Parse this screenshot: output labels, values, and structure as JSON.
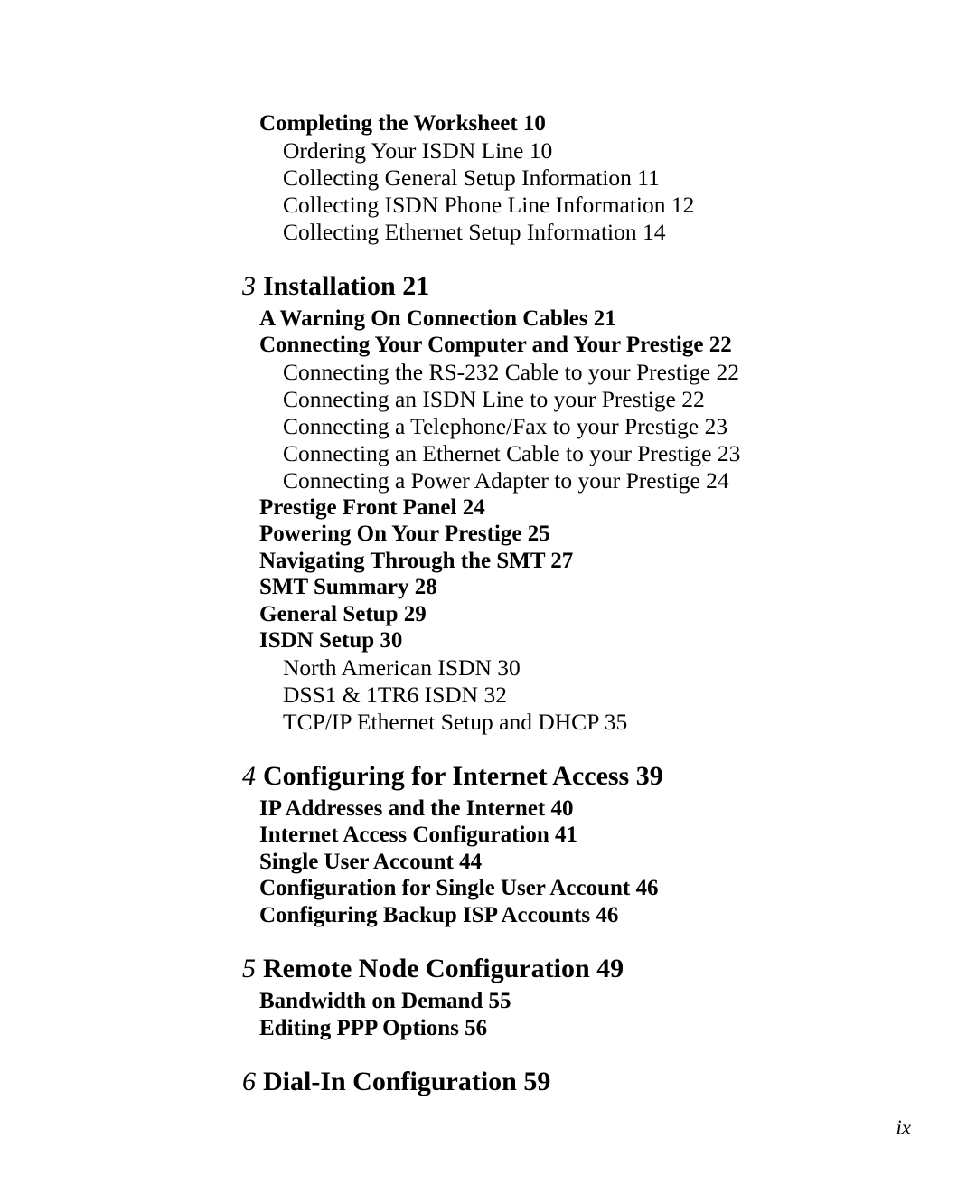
{
  "page": {
    "folio": "ix",
    "background_color": "#ffffff",
    "text_color": "#000000"
  },
  "toc": {
    "entries": [
      {
        "level": 2,
        "label": "Completing the Worksheet 10",
        "title": "Completing the Worksheet",
        "page": "10"
      },
      {
        "level": 3,
        "label": "Ordering Your ISDN Line 10",
        "title": "Ordering Your ISDN Line",
        "page": "10"
      },
      {
        "level": 3,
        "label": "Collecting General Setup Information 11",
        "title": "Collecting General Setup Information",
        "page": "11"
      },
      {
        "level": 3,
        "label": "Collecting ISDN Phone Line Information 12",
        "title": "Collecting ISDN Phone Line Information",
        "page": "12"
      },
      {
        "level": 3,
        "label": "Collecting Ethernet Setup Information 14",
        "title": "Collecting Ethernet Setup Information",
        "page": "14"
      },
      {
        "level": 1,
        "number": "3",
        "label": "Installation 21",
        "title": "Installation",
        "page": "21"
      },
      {
        "level": 2,
        "label": "A Warning On Connection Cables 21",
        "title": "A Warning On Connection Cables",
        "page": "21"
      },
      {
        "level": 2,
        "label": "Connecting Your Computer and Your Prestige 22",
        "title": "Connecting Your Computer and Your Prestige",
        "page": "22"
      },
      {
        "level": 3,
        "label": "Connecting the RS-232 Cable to your Prestige 22",
        "title": "Connecting the RS-232 Cable to your Prestige",
        "page": "22"
      },
      {
        "level": 3,
        "label": "Connecting an ISDN Line to your Prestige 22",
        "title": "Connecting an ISDN Line to your Prestige",
        "page": "22"
      },
      {
        "level": 3,
        "label": "Connecting a Telephone/Fax to your Prestige 23",
        "title": "Connecting a Telephone/Fax to your Prestige",
        "page": "23"
      },
      {
        "level": 3,
        "label": "Connecting an Ethernet Cable to your Prestige 23",
        "title": "Connecting an Ethernet Cable to your Prestige",
        "page": "23"
      },
      {
        "level": 3,
        "label": "Connecting a Power Adapter to your Prestige 24",
        "title": "Connecting a Power Adapter to your Prestige",
        "page": "24"
      },
      {
        "level": 2,
        "label": "Prestige Front Panel 24",
        "title": "Prestige Front Panel",
        "page": "24"
      },
      {
        "level": 2,
        "label": "Powering On Your Prestige 25",
        "title": "Powering On Your Prestige",
        "page": "25"
      },
      {
        "level": 2,
        "label": "Navigating Through the SMT 27",
        "title": "Navigating Through the SMT",
        "page": "27"
      },
      {
        "level": 2,
        "label": "SMT Summary 28",
        "title": "SMT Summary",
        "page": "28"
      },
      {
        "level": 2,
        "label": "General Setup 29",
        "title": "General Setup",
        "page": "29"
      },
      {
        "level": 2,
        "label": "ISDN Setup 30",
        "title": "ISDN Setup",
        "page": "30"
      },
      {
        "level": 3,
        "label": "North American ISDN 30",
        "title": "North American ISDN",
        "page": "30"
      },
      {
        "level": 3,
        "label": "DSS1 & 1TR6 ISDN 32",
        "title": "DSS1 & 1TR6 ISDN",
        "page": "32"
      },
      {
        "level": 3,
        "label": "TCP/IP Ethernet Setup and DHCP 35",
        "title": "TCP/IP Ethernet Setup and DHCP",
        "page": "35"
      },
      {
        "level": 1,
        "number": "4",
        "label": "Configuring for Internet Access 39",
        "title": "Configuring for Internet Access",
        "page": "39"
      },
      {
        "level": 2,
        "label": "IP Addresses and the Internet 40",
        "title": "IP Addresses and the Internet",
        "page": "40"
      },
      {
        "level": 2,
        "label": "Internet Access Configuration 41",
        "title": "Internet Access Configuration",
        "page": "41"
      },
      {
        "level": 2,
        "label": "Single User Account 44",
        "title": "Single User Account",
        "page": "44"
      },
      {
        "level": 2,
        "label": "Configuration for Single User Account 46",
        "title": "Configuration for Single User Account",
        "page": "46"
      },
      {
        "level": 2,
        "label": "Configuring Backup ISP Accounts 46",
        "title": "Configuring Backup ISP Accounts",
        "page": "46"
      },
      {
        "level": 1,
        "number": "5",
        "label": "Remote Node Configuration 49",
        "title": "Remote Node Configuration",
        "page": "49"
      },
      {
        "level": 2,
        "label": "Bandwidth on Demand 55",
        "title": "Bandwidth on Demand",
        "page": "55"
      },
      {
        "level": 2,
        "label": "Editing PPP Options 56",
        "title": "Editing PPP Options",
        "page": "56"
      },
      {
        "level": 1,
        "number": "6",
        "label": "Dial-In Configuration 59",
        "title": "Dial-In Configuration",
        "page": "59"
      }
    ]
  }
}
